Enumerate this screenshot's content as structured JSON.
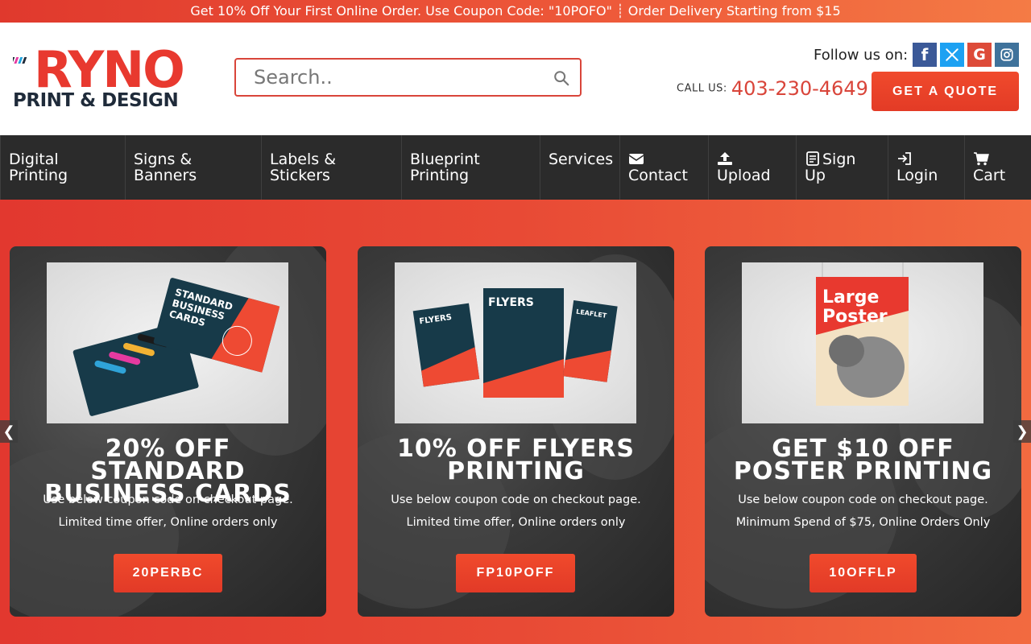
{
  "promo": {
    "text": "Get 10% Off Your First Online Order. Use Coupon Code: \"10POFO\" ┊ Order Delivery Starting from $15"
  },
  "header": {
    "logo": {
      "line1": "RYNO",
      "line2": "PRINT & DESIGN"
    },
    "search": {
      "placeholder": "Search..",
      "value": ""
    },
    "follow_label": "Follow us on:",
    "social": [
      {
        "name": "facebook",
        "glyph": "f",
        "color": "#3b5998"
      },
      {
        "name": "x-twitter",
        "glyph": "𝕏",
        "color": "#1da1f2"
      },
      {
        "name": "google",
        "glyph": "G",
        "color": "#dd4b39"
      },
      {
        "name": "instagram",
        "glyph": "◎",
        "color": "#3f729b"
      }
    ],
    "call_label": "CALL US:",
    "phone": "403-230-4649",
    "quote_button": "GET A QUOTE"
  },
  "nav": {
    "items": [
      {
        "label": "Digital Printing",
        "icon": null
      },
      {
        "label": "Signs & Banners",
        "icon": null
      },
      {
        "label": "Labels & Stickers",
        "icon": null
      },
      {
        "label": "Blueprint Printing",
        "icon": null
      },
      {
        "label": "Services",
        "icon": null
      },
      {
        "label": "Contact",
        "icon": "envelope-icon"
      },
      {
        "label": "Upload",
        "icon": "upload-icon"
      },
      {
        "label": "Sign Up",
        "icon": "form-icon"
      },
      {
        "label": "Login",
        "icon": "login-icon"
      },
      {
        "label": "Cart",
        "icon": "cart-icon"
      }
    ]
  },
  "promos": [
    {
      "title": "20% OFF STANDARD BUSINESS CARDS",
      "line1": "Use below coupon code on checkout page.",
      "line2": "Limited time offer, Online orders only",
      "code": "20PERBC",
      "image_text": "STANDARD BUSINESS CARDS"
    },
    {
      "title": "10% OFF FLYERS PRINTING",
      "line1": "Use below coupon code on checkout page.",
      "line2": "Limited time offer, Online orders only",
      "code": "FP10POFF",
      "image_text": "FLYERS"
    },
    {
      "title": "GET $10 OFF POSTER PRINTING",
      "line1": "Use below coupon code on checkout page.",
      "line2": "Minimum Spend of $75, Online Orders Only",
      "code": "10OFFLP",
      "image_text": "Large Poster"
    }
  ],
  "carousel": {
    "prev": "❮",
    "next": "❯"
  },
  "colors": {
    "brand_red": "#e8392f",
    "nav_bg": "#2b2b2b",
    "logo_dark": "#1f2b3a"
  }
}
